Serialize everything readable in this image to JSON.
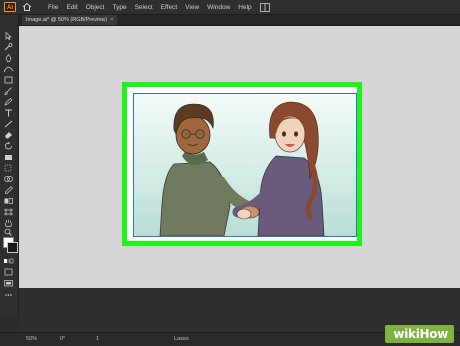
{
  "app": {
    "logo": "Ai",
    "menu": [
      "File",
      "Edit",
      "Object",
      "Type",
      "Select",
      "Effect",
      "View",
      "Window",
      "Help"
    ]
  },
  "document": {
    "tab_title": "Image.ai* @ 50% (RGB/Preview)",
    "close_symbol": "×"
  },
  "status": {
    "zoom": "50%",
    "rotation": "0°",
    "page": "1",
    "tool": "Lasso"
  },
  "watermark": {
    "part1": "wiki",
    "part2": "How"
  },
  "colors": {
    "highlight": "#1df41a",
    "accent": "#ff9a00",
    "watermark_bg": "#7fb23f"
  },
  "icons": [
    "home-icon",
    "arrange-documents-icon",
    "selection-icon",
    "direct-selection-icon",
    "magic-wand-icon",
    "lasso-icon",
    "pen-icon",
    "curvature-icon",
    "rectangle-icon",
    "paintbrush-icon",
    "shaper-icon",
    "pencil-icon",
    "type-icon",
    "line-icon",
    "eraser-icon",
    "rotate-icon",
    "scale-icon",
    "width-icon",
    "free-transform-icon",
    "shape-builder-icon",
    "perspective-icon",
    "mesh-icon",
    "gradient-icon",
    "eyedropper-icon",
    "blend-icon",
    "symbol-sprayer-icon",
    "column-graph-icon",
    "artboard-icon",
    "slice-icon",
    "hand-icon",
    "zoom-icon"
  ]
}
